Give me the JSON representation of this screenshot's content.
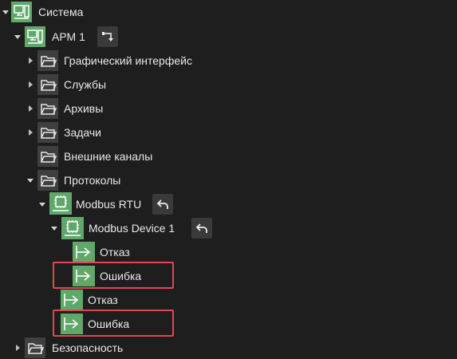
{
  "tree": {
    "sistema": "Система",
    "arm1": "АРМ 1",
    "graphic_ui": "Графический интерфейс",
    "services": "Службы",
    "archives": "Архивы",
    "tasks": "Задачи",
    "external_channels": "Внешние каналы",
    "protocols": "Протоколы",
    "modbus_rtu": "Modbus RTU",
    "modbus_device1": "Modbus Device 1",
    "device_refusal": "Отказ",
    "device_error": "Ошибка",
    "rtu_refusal": "Отказ",
    "rtu_error": "Ошибка",
    "security": "Безопасность"
  },
  "colors": {
    "background": "#1e1e1e",
    "accent_green": "#5fa86a",
    "folder_bg": "#3f3f3f",
    "highlight_red": "#e0484e"
  },
  "icons": {
    "computer": "computer-icon",
    "folder": "folder-icon",
    "signal": "signal-arrow-icon",
    "device": "device-chip-icon",
    "back": "back-arrow-icon",
    "route": "route-icon"
  }
}
